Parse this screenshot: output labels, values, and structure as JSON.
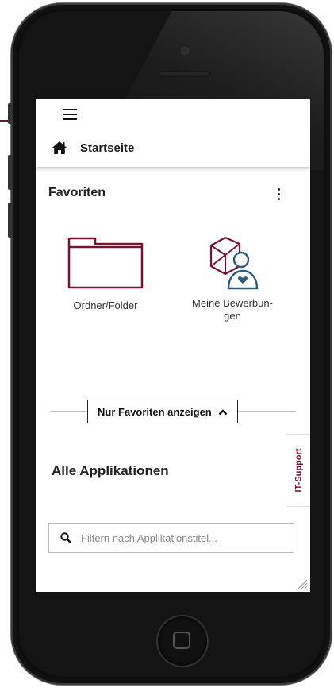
{
  "topbar": {
    "menu_icon": "hamburger-menu-icon",
    "breadcrumb": {
      "icon": "home-icon",
      "label": "Startseite"
    }
  },
  "favorites": {
    "title": "Favoriten",
    "menu_icon": "kebab-menu-icon",
    "tiles": [
      {
        "label": "Ordner/Folder",
        "icon": "folder-icon"
      },
      {
        "label_line1": "Meine Bewerbun-",
        "label_line2": "gen",
        "icon": "applications-person-icon"
      }
    ],
    "toggle_label": "Nur Favoriten anzeigen",
    "toggle_icon": "chevron-up-icon"
  },
  "all_apps": {
    "title": "Alle Applikationen",
    "filter_placeholder": "Filtern nach Applikationstitel...",
    "filter_value": "",
    "filter_icon": "search-icon"
  },
  "side_tab": {
    "label": "IT-Support"
  },
  "colors": {
    "accent": "#7a1230",
    "secondary": "#2d5b7e",
    "pointer": "#6b1530"
  }
}
